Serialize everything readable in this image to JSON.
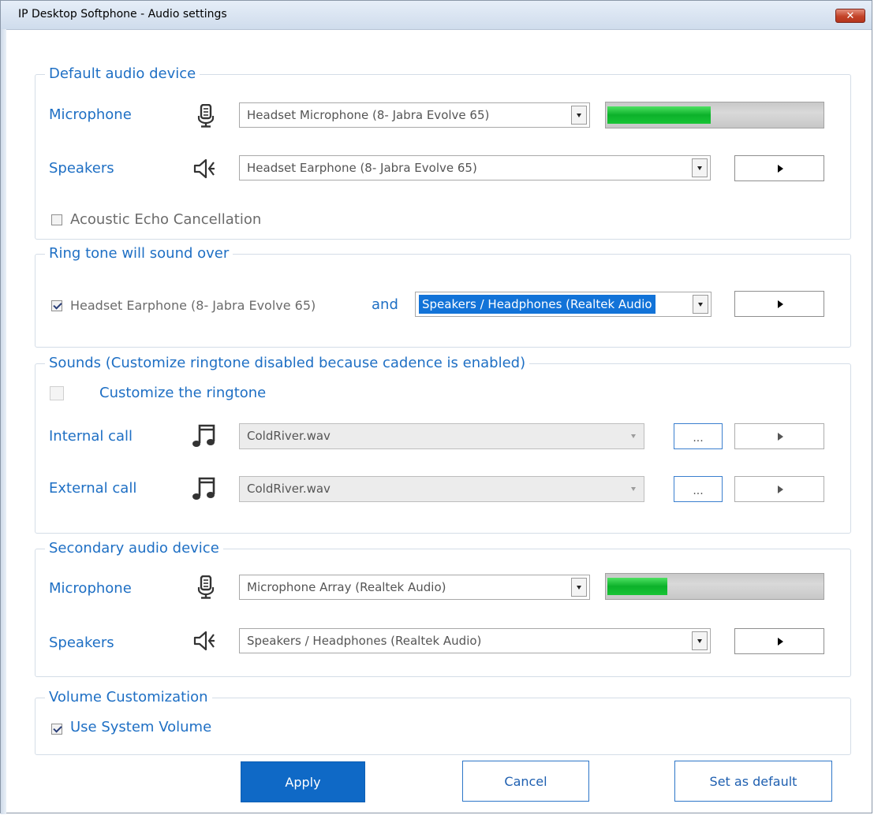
{
  "window": {
    "title": "IP Desktop Softphone - Audio settings",
    "close_label": "✕"
  },
  "default_device": {
    "legend": "Default audio device",
    "microphone": {
      "label": "Microphone",
      "value": "Headset Microphone (8- Jabra Evolve 65)",
      "level": 0.48
    },
    "speakers": {
      "label": "Speakers",
      "value": "Headset Earphone (8- Jabra Evolve 65)"
    },
    "aec": {
      "label": "Acoustic Echo Cancellation",
      "checked": false
    }
  },
  "ring": {
    "legend": "Ring tone will sound over",
    "primary": {
      "label": "Headset Earphone (8- Jabra Evolve 65)",
      "checked": true
    },
    "and_label": "and",
    "secondary_value": "Speakers / Headphones (Realtek Audio"
  },
  "sounds": {
    "legend": "Sounds (Customize ringtone disabled because cadence is enabled)",
    "customize_label": "Customize the ringtone",
    "internal": {
      "label": "Internal call",
      "value": "ColdRiver.wav",
      "browse_label": "..."
    },
    "external": {
      "label": "External call",
      "value": "ColdRiver.wav",
      "browse_label": "..."
    }
  },
  "secondary_device": {
    "legend": "Secondary audio device",
    "microphone": {
      "label": "Microphone",
      "value": "Microphone Array (Realtek Audio)",
      "level": 0.28
    },
    "speakers": {
      "label": "Speakers",
      "value": "Speakers / Headphones (Realtek Audio)"
    }
  },
  "volume": {
    "legend": "Volume Customization",
    "use_system_label": "Use System Volume",
    "checked": true
  },
  "buttons": {
    "apply": "Apply",
    "cancel": "Cancel",
    "default": "Set as default"
  }
}
